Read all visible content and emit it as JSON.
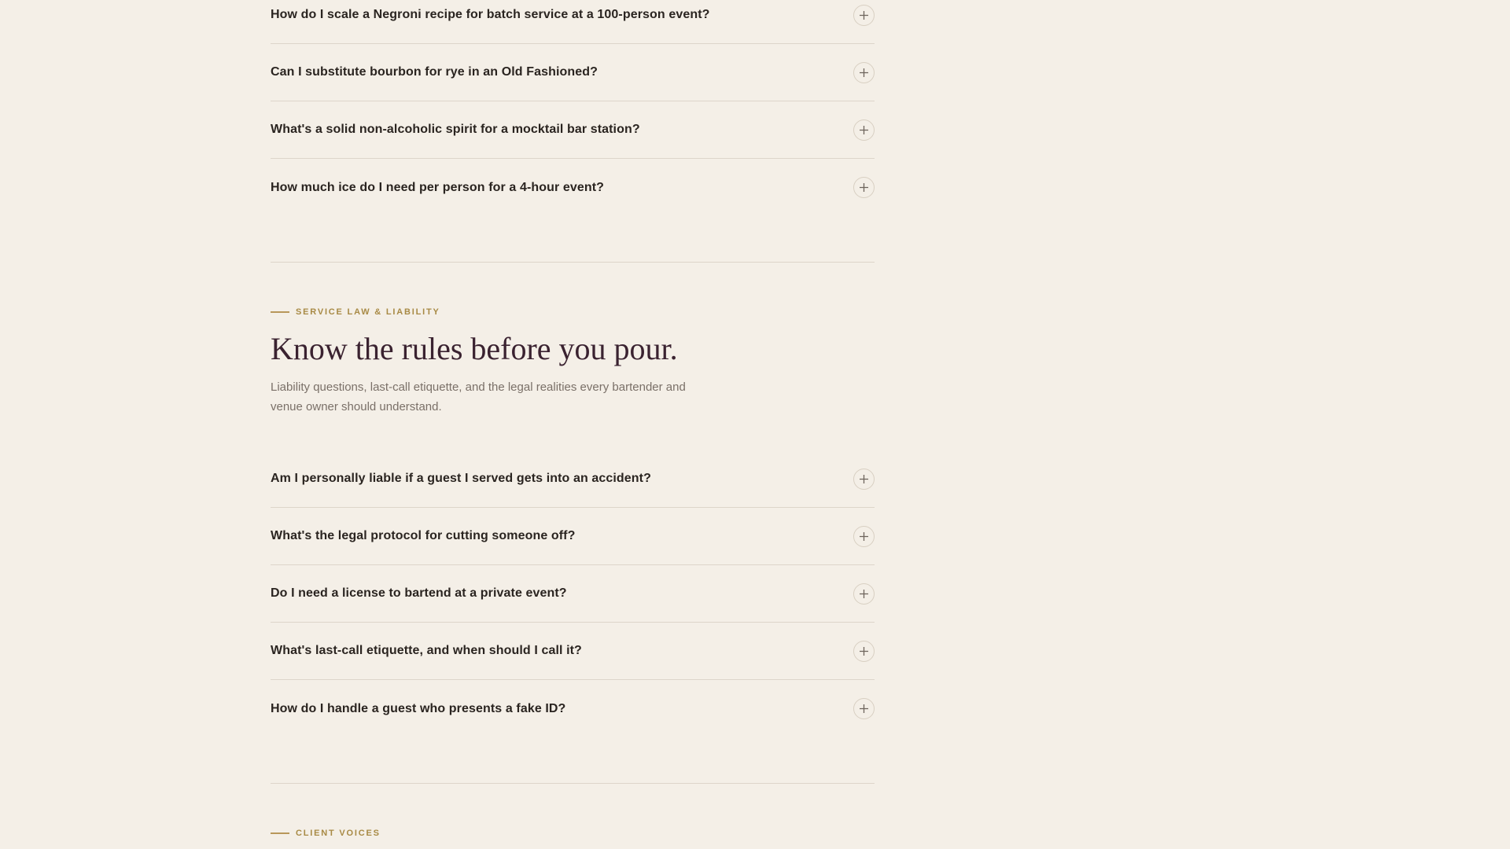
{
  "faq_top": {
    "items": [
      "How do I scale a Negroni recipe for batch service at a 100-person event?",
      "Can I substitute bourbon for rye in an Old Fashioned?",
      "What's a solid non-alcoholic spirit for a mocktail bar station?",
      "How much ice do I need per person for a 4-hour event?"
    ]
  },
  "law_section": {
    "eyebrow": "SERVICE LAW & LIABILITY",
    "heading": "Know the rules before you pour.",
    "lead": "Liability questions, last-call etiquette, and the legal realities every bartender and venue owner should understand.",
    "items": [
      "Am I personally liable if a guest I served gets into an accident?",
      "What's the legal protocol for cutting someone off?",
      "Do I need a license to bartend at a private event?",
      "What's last-call etiquette, and when should I call it?",
      "How do I handle a guest who presents a fake ID?"
    ]
  },
  "client_voices": {
    "eyebrow": "CLIENT VOICES"
  },
  "icons": {
    "expand": "plus-icon"
  },
  "colors": {
    "background": "#f4efe7",
    "accent_gold": "#a88a45",
    "heading_plum": "#3a2230",
    "divider": "#ddd5ca"
  }
}
